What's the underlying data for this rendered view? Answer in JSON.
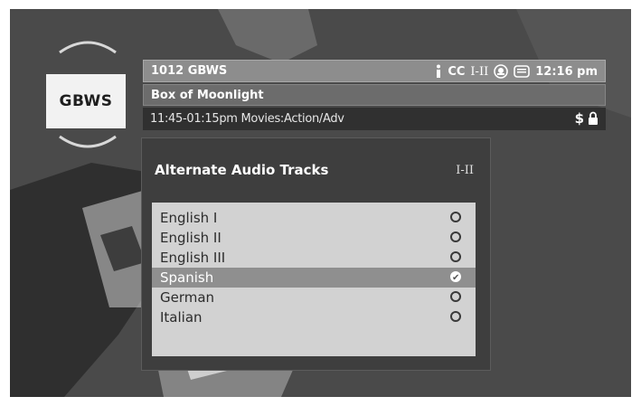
{
  "channel": {
    "name": "GBWS",
    "up_icon": "chevron-up-icon",
    "down_icon": "chevron-down-icon"
  },
  "info_banner": {
    "channel_line": "1012 GBWS",
    "status_icons": [
      "info-icon",
      "rating-icon",
      "message-icon"
    ],
    "cc_label": "CC",
    "audio_mode": "I-II",
    "clock": "12:16 pm",
    "program_title": "Box of Moonlight",
    "schedule": "11:45-01:15pm Movies:Action/Adv",
    "pay_symbol": "$",
    "lock_icon": "lock-icon"
  },
  "audio_dialog": {
    "title": "Alternate Audio Tracks",
    "mode": "I-II",
    "tracks": [
      {
        "label": "English I",
        "selected": false
      },
      {
        "label": "English II",
        "selected": false
      },
      {
        "label": "English III",
        "selected": false
      },
      {
        "label": "Spanish",
        "selected": true
      },
      {
        "label": "German",
        "selected": false
      },
      {
        "label": "Italian",
        "selected": false
      }
    ]
  },
  "colors": {
    "background": "#4b4b4b",
    "panel": "#3e3e3e",
    "list": "#d2d2d2",
    "highlight": "#8f8f8f",
    "channel_box": "#f2f2f2"
  }
}
